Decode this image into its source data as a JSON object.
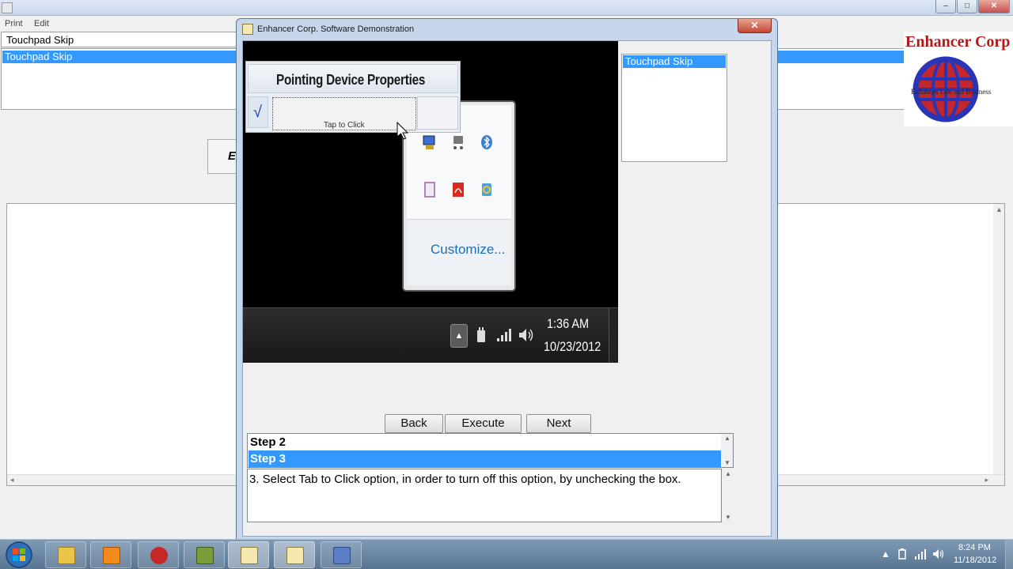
{
  "background_app": {
    "menu": {
      "print": "Print",
      "edit": "Edit"
    },
    "name_field_value": "Touchpad Skip",
    "list_selected_item": "Touchpad Skip",
    "button_stub_label": "E"
  },
  "logo": {
    "title": "Enhancer Corp",
    "tagline": "Enhances Life and Business"
  },
  "dialog": {
    "title": "Enhancer Corp. Software Demonstration",
    "close_label": "✕",
    "screenshot": {
      "pointing_device_title": "Pointing Device Properties",
      "check_mark": "√",
      "tap_to_click_label": "Tap to Click",
      "customize_link": "Customize...",
      "tray_up_arrow": "▲",
      "time": "1:36 AM",
      "date": "10/23/2012"
    },
    "macro_list": [
      "Touchpad Skip"
    ],
    "buttons": {
      "back": "Back",
      "execute": "Execute",
      "next": "Next"
    },
    "steps": [
      {
        "label": "Step 2",
        "selected": false
      },
      {
        "label": "Step 3",
        "selected": true
      }
    ],
    "step_description": "3.  Select Tab to Click option, in order to turn off this option, by unchecking the box."
  },
  "taskbar": {
    "time": "8:24 PM",
    "date": "11/18/2012",
    "tray_up_arrow": "▲"
  },
  "colors": {
    "selection": "#3399ff",
    "logo_red": "#b11a1a",
    "logo_blue": "#2a35b5"
  }
}
